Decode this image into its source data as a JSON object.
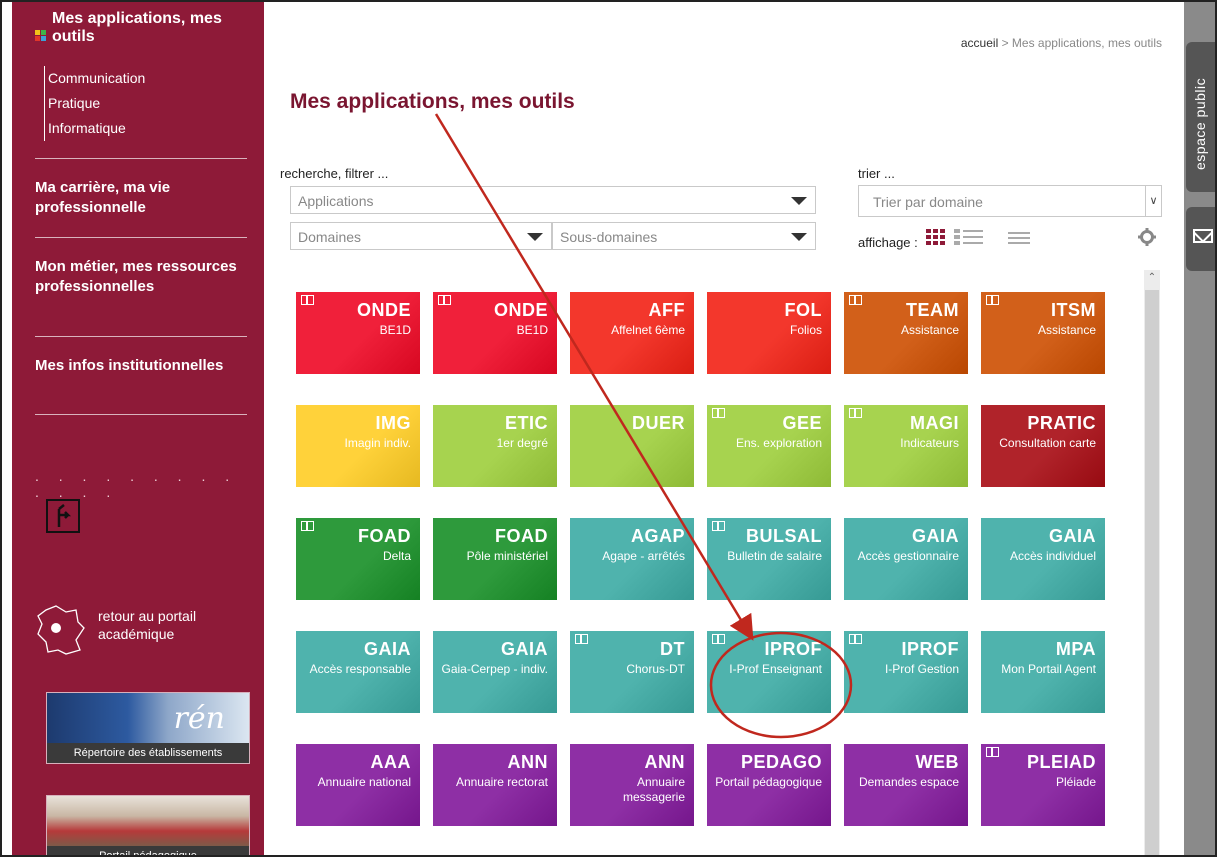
{
  "sidebar": {
    "section_title": "Mes applications, mes outils",
    "sub_items": [
      "Communication",
      "Pratique",
      "Informatique"
    ],
    "sections": [
      "Ma carrière, ma vie professionnelle",
      "Mon métier, mes ressources professionnelles",
      "Mes infos institutionnelles"
    ],
    "dots": ". . . . . . . . . . . . .",
    "return_portal": "retour au portail académique",
    "banner_directory_caption": "Répertoire des établissements",
    "banner_directory_logo": "rén",
    "banner_pedago_caption": "Portail pédagogique"
  },
  "breadcrumb": {
    "home": "accueil",
    "separator": " > ",
    "current": "Mes applications, mes outils"
  },
  "page_title": "Mes applications, mes outils",
  "filters": {
    "search_label": "recherche, filtrer ...",
    "applications_placeholder": "Applications",
    "domains_placeholder": "Domaines",
    "subdomains_placeholder": "Sous-domaines",
    "sort_label": "trier ...",
    "sort_value": "Trier par domaine",
    "display_label": "affichage :"
  },
  "tiles": [
    {
      "code": "ONDE",
      "sub": "BE1D",
      "book": true,
      "color": "red"
    },
    {
      "code": "ONDE",
      "sub": "BE1D",
      "book": true,
      "color": "red"
    },
    {
      "code": "AFF",
      "sub": "Affelnet 6ème",
      "book": false,
      "color": "red2"
    },
    {
      "code": "FOL",
      "sub": "Folios",
      "book": false,
      "color": "red2"
    },
    {
      "code": "TEAM",
      "sub": "Assistance",
      "book": true,
      "color": "orange"
    },
    {
      "code": "ITSM",
      "sub": "Assistance",
      "book": true,
      "color": "orange"
    },
    {
      "code": "IMG",
      "sub": "Imagin indiv.",
      "book": false,
      "color": "yellow"
    },
    {
      "code": "ETIC",
      "sub": "1er degré",
      "book": false,
      "color": "lime"
    },
    {
      "code": "DUER",
      "sub": "",
      "book": false,
      "color": "lime"
    },
    {
      "code": "GEE",
      "sub": "Ens. exploration",
      "book": true,
      "color": "lime"
    },
    {
      "code": "MAGI",
      "sub": "Indicateurs",
      "book": true,
      "color": "lime"
    },
    {
      "code": "PRATIC",
      "sub": "Consultation carte",
      "book": false,
      "color": "darkred"
    },
    {
      "code": "FOAD",
      "sub": "Delta",
      "book": true,
      "color": "green"
    },
    {
      "code": "FOAD",
      "sub": "Pôle ministériel",
      "book": false,
      "color": "green"
    },
    {
      "code": "AGAP",
      "sub": "Agape - arrêtés",
      "book": false,
      "color": "teal"
    },
    {
      "code": "BULSAL",
      "sub": "Bulletin de salaire",
      "book": true,
      "color": "teal"
    },
    {
      "code": "GAIA",
      "sub": "Accès gestionnaire",
      "book": false,
      "color": "teal"
    },
    {
      "code": "GAIA",
      "sub": "Accès individuel",
      "book": false,
      "color": "teal"
    },
    {
      "code": "GAIA",
      "sub": "Accès responsable",
      "book": false,
      "color": "teal"
    },
    {
      "code": "GAIA",
      "sub": "Gaia-Cerpep - indiv.",
      "book": false,
      "color": "teal"
    },
    {
      "code": "DT",
      "sub": "Chorus-DT",
      "book": true,
      "color": "teal"
    },
    {
      "code": "IPROF",
      "sub": "I-Prof Enseignant",
      "book": true,
      "color": "teal"
    },
    {
      "code": "IPROF",
      "sub": "I-Prof Gestion",
      "book": true,
      "color": "teal"
    },
    {
      "code": "MPA",
      "sub": "Mon Portail Agent",
      "book": false,
      "color": "teal"
    },
    {
      "code": "AAA",
      "sub": "Annuaire national",
      "book": false,
      "color": "purple"
    },
    {
      "code": "ANN",
      "sub": "Annuaire rectorat",
      "book": false,
      "color": "purple"
    },
    {
      "code": "ANN",
      "sub": "Annuaire messagerie",
      "book": false,
      "color": "purple"
    },
    {
      "code": "PEDAGO",
      "sub": "Portail pédagogique",
      "book": false,
      "color": "purple"
    },
    {
      "code": "WEB",
      "sub": "Demandes espace",
      "book": false,
      "color": "purple"
    },
    {
      "code": "PLEIAD",
      "sub": "Pléiade",
      "book": true,
      "color": "purple"
    }
  ],
  "tile_colors": {
    "red": "#f0203a",
    "red2": "#f3372c",
    "orange": "#d2601a",
    "yellow": "#ffd23a",
    "lime": "#a7d34f",
    "darkred": "#b0232a",
    "green": "#2e9a3c",
    "teal": "#4fb3ad",
    "purple": "#8e2fa5"
  },
  "right_strip": {
    "public_tab": "espace public"
  },
  "colors": {
    "sidebar": "#8e1a38",
    "title": "#7a1530",
    "annotation": "#c0281e"
  }
}
